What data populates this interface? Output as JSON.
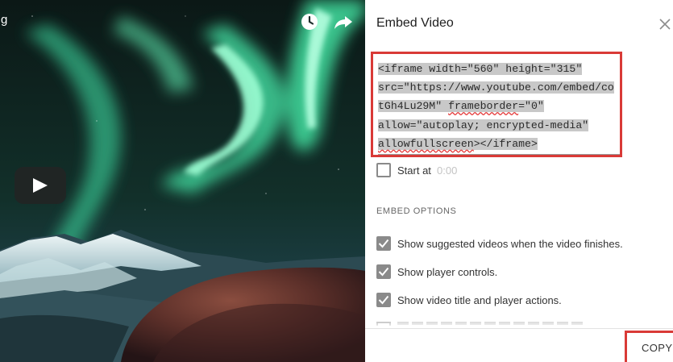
{
  "video": {
    "icons": [
      "watch-later-icon",
      "share-icon",
      "play-icon"
    ],
    "left_edge_glyph": "g"
  },
  "dialog": {
    "title": "Embed Video",
    "close_icon": "close-icon",
    "embed_code_lines": [
      "<iframe width=\"560\" height=\"315\"",
      "src=\"https://www.youtube.com/embed/co",
      "tGh4Lu29M\" frameborder=\"0\"",
      "allow=\"autoplay; encrypted-media\"",
      "allowfullscreen></iframe>"
    ],
    "start_at": {
      "label": "Start at",
      "time_placeholder": "0:00",
      "checked": false
    },
    "embed_options_heading": "EMBED OPTIONS",
    "options": [
      {
        "label": "Show suggested videos when the video finishes.",
        "checked": true
      },
      {
        "label": "Show player controls.",
        "checked": true
      },
      {
        "label": "Show video title and player actions.",
        "checked": true
      }
    ],
    "copy_label": "COPY"
  },
  "colors": {
    "highlight_box": "#d93a37",
    "checkbox": "#8a8a8a",
    "selection": "#c8c8c8"
  }
}
